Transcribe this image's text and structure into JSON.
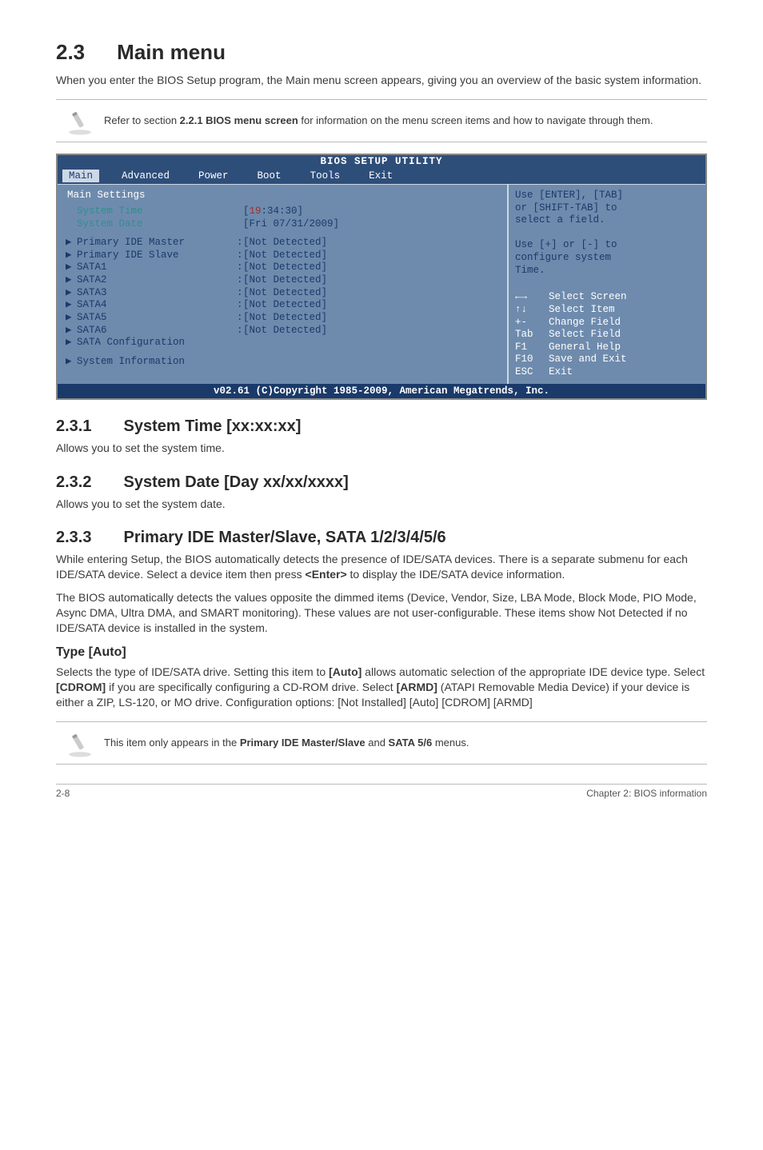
{
  "h1_num": "2.3",
  "h1_title": "Main menu",
  "intro": "When you enter the BIOS Setup program, the Main menu screen appears, giving you an overview of the basic system information.",
  "note1": "Refer to section 2.2.1 BIOS menu screen for information on the menu screen items and how to navigate through them.",
  "bios": {
    "title": "BIOS SETUP UTILITY",
    "menus": [
      "Main",
      "Advanced",
      "Power",
      "Boot",
      "Tools",
      "Exit"
    ],
    "section_label": "Main Settings",
    "rows_top": [
      {
        "arrow": "",
        "label": "System Time",
        "label_class": "label",
        "sep": "",
        "value_html": "[<span class='hl'>19</span>:34:30]"
      },
      {
        "arrow": "",
        "label": "System Date",
        "label_class": "label",
        "sep": "",
        "value_html": "[Fri 07/31/2009]"
      }
    ],
    "rows_mid": [
      {
        "arrow": "▶",
        "label": "Primary IDE Master",
        "label_class": "label-blue",
        "sep": ":",
        "value_html": "[Not Detected]"
      },
      {
        "arrow": "▶",
        "label": "Primary IDE Slave",
        "label_class": "label-blue",
        "sep": ":",
        "value_html": "[Not Detected]"
      },
      {
        "arrow": "▶",
        "label": "SATA1",
        "label_class": "label-blue",
        "sep": ":",
        "value_html": "[Not Detected]"
      },
      {
        "arrow": "▶",
        "label": "SATA2",
        "label_class": "label-blue",
        "sep": ":",
        "value_html": "[Not Detected]"
      },
      {
        "arrow": "▶",
        "label": "SATA3",
        "label_class": "label-blue",
        "sep": ":",
        "value_html": "[Not Detected]"
      },
      {
        "arrow": "▶",
        "label": "SATA4",
        "label_class": "label-blue",
        "sep": ":",
        "value_html": "[Not Detected]"
      },
      {
        "arrow": "▶",
        "label": "SATA5",
        "label_class": "label-blue",
        "sep": ":",
        "value_html": "[Not Detected]"
      },
      {
        "arrow": "▶",
        "label": "SATA6",
        "label_class": "label-blue",
        "sep": ":",
        "value_html": "[Not Detected]"
      },
      {
        "arrow": "▶",
        "label": "SATA Configuration",
        "label_class": "label-blue",
        "sep": "",
        "value_html": ""
      }
    ],
    "rows_bot": [
      {
        "arrow": "▶",
        "label": "System Information",
        "label_class": "label-blue",
        "sep": "",
        "value_html": ""
      }
    ],
    "help_top": [
      "Use [ENTER], [TAB]",
      "or [SHIFT-TAB] to",
      "select a field.",
      "",
      "Use [+] or [-] to",
      "configure system",
      "Time."
    ],
    "legend": [
      {
        "k": "←→",
        "d": "Select Screen"
      },
      {
        "k": "↑↓",
        "d": "Select Item"
      },
      {
        "k": "+-",
        "d": "Change Field"
      },
      {
        "k": "Tab",
        "d": "Select Field"
      },
      {
        "k": "F1",
        "d": "General Help"
      },
      {
        "k": "F10",
        "d": "Save and Exit"
      },
      {
        "k": "ESC",
        "d": "Exit"
      }
    ],
    "footer": "v02.61 (C)Copyright 1985-2009, American Megatrends, Inc."
  },
  "s231_num": "2.3.1",
  "s231_title": "System Time [xx:xx:xx]",
  "s231_body": "Allows you to set the system time.",
  "s232_num": "2.3.2",
  "s232_title": "System Date [Day xx/xx/xxxx]",
  "s232_body": "Allows you to set the system date.",
  "s233_num": "2.3.3",
  "s233_title": "Primary IDE Master/Slave, SATA 1/2/3/4/5/6",
  "s233_p1": "While entering Setup, the BIOS automatically detects the presence of IDE/SATA devices. There is a separate submenu for each IDE/SATA device. Select a device item then press <Enter> to display the IDE/SATA device information.",
  "s233_p2": "The BIOS automatically detects the values opposite the dimmed items (Device, Vendor, Size, LBA Mode, Block Mode, PIO Mode, Async DMA, Ultra DMA, and SMART monitoring). These values are not user-configurable. These items show Not Detected if no IDE/SATA device is installed in the system.",
  "type_auto_h": "Type [Auto]",
  "type_auto_p": "Selects the type of IDE/SATA drive. Setting this item to [Auto] allows automatic selection of the appropriate IDE device type. Select [CDROM] if you are specifically configuring a CD-ROM drive. Select [ARMD] (ATAPI Removable Media Device) if your device is either a ZIP, LS-120, or MO drive. Configuration options: [Not Installed] [Auto] [CDROM] [ARMD]",
  "note2": "This item only appears in the Primary IDE Master/Slave and SATA 5/6 menus.",
  "footer_left": "2-8",
  "footer_right": "Chapter 2: BIOS information"
}
